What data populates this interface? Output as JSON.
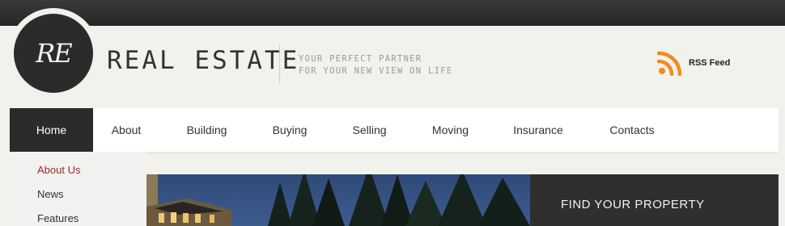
{
  "logo": {
    "mark": "RE"
  },
  "header": {
    "title": "REAL ESTATE",
    "tagline_line1": "YOUR PERFECT PARTNER",
    "tagline_line2": "FOR YOUR NEW VIEW ON LIFE"
  },
  "rss": {
    "label": "RSS Feed",
    "icon": "rss-icon",
    "color": "#f28c1b"
  },
  "nav": {
    "items": [
      {
        "label": "Home",
        "active": true
      },
      {
        "label": "About"
      },
      {
        "label": "Building"
      },
      {
        "label": "Buying"
      },
      {
        "label": "Selling"
      },
      {
        "label": "Moving"
      },
      {
        "label": "Insurance"
      },
      {
        "label": "Contacts"
      }
    ]
  },
  "dropdown": {
    "items": [
      {
        "label": "About Us",
        "active": true
      },
      {
        "label": "News"
      },
      {
        "label": "Features"
      }
    ]
  },
  "find": {
    "title": "FIND YOUR PROPERTY"
  },
  "colors": {
    "dark": "#2b2b2b",
    "accent": "#9b2b2b",
    "background": "#f2f2ed"
  }
}
